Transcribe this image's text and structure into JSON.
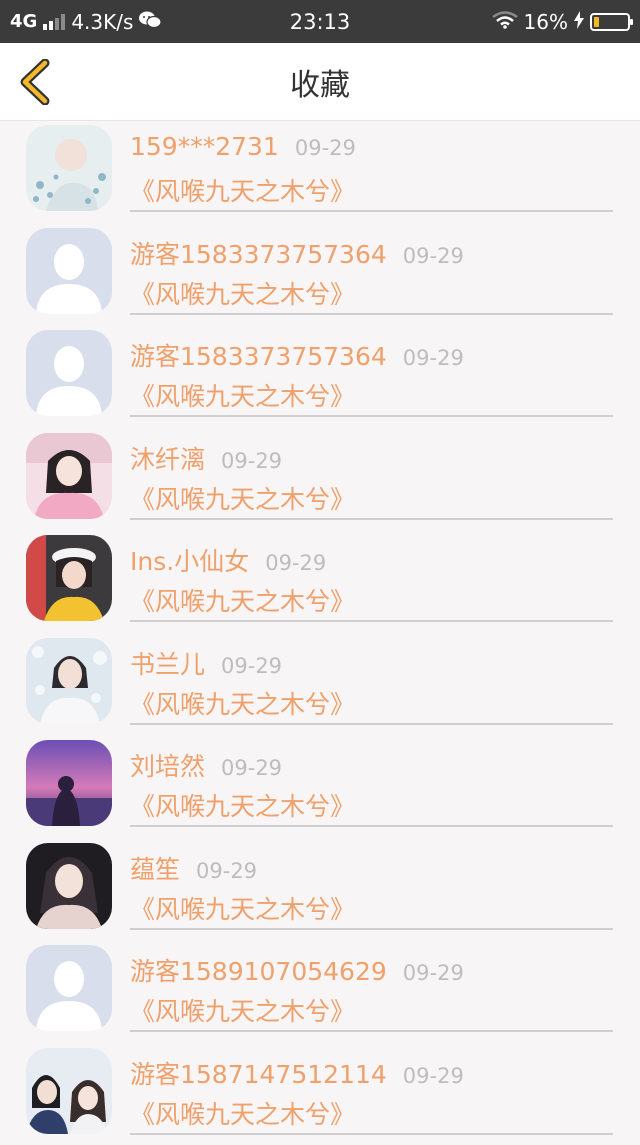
{
  "status_bar": {
    "network": "4G",
    "speed": "4.3K/s",
    "time": "23:13",
    "battery_percent": "16%",
    "battery_level": 0.16,
    "icons": [
      "signal-icon",
      "wechat-icon",
      "wifi-icon",
      "charging-icon",
      "battery-icon"
    ]
  },
  "header": {
    "title": "收藏",
    "back_icon": "chevron-left-icon",
    "accent": "#f3b928"
  },
  "colors": {
    "name_text": "#f0a06a",
    "date_text": "#bdbdbd",
    "divider": "#cfcfcf",
    "background": "#f7f5f6"
  },
  "items": [
    {
      "name": "159***2731",
      "date": "09-29",
      "book": "《风喉九天之木兮》",
      "avatar": "blue-flower-photo"
    },
    {
      "name": "游客1583373757364",
      "date": "09-29",
      "book": "《风喉九天之木兮》",
      "avatar": "default-silhouette"
    },
    {
      "name": "游客1583373757364",
      "date": "09-29",
      "book": "《风喉九天之木兮》",
      "avatar": "default-silhouette"
    },
    {
      "name": "沐纤漓",
      "date": "09-29",
      "book": "《风喉九天之木兮》",
      "avatar": "girl-pink-photo"
    },
    {
      "name": "Ins.小仙女",
      "date": "09-29",
      "book": "《风喉九天之木兮》",
      "avatar": "girl-hat-photo"
    },
    {
      "name": "书兰儿",
      "date": "09-29",
      "book": "《风喉九天之木兮》",
      "avatar": "man-white-robe-photo"
    },
    {
      "name": "刘培然",
      "date": "09-29",
      "book": "《风喉九天之木兮》",
      "avatar": "purple-sunset-photo"
    },
    {
      "name": "蕴笙",
      "date": "09-29",
      "book": "《风喉九天之木兮》",
      "avatar": "girl-dark-photo"
    },
    {
      "name": "游客1589107054629",
      "date": "09-29",
      "book": "《风喉九天之木兮》",
      "avatar": "default-silhouette"
    },
    {
      "name": "游客1587147512114",
      "date": "09-29",
      "book": "《风喉九天之木兮》",
      "avatar": "couple-photo"
    }
  ]
}
